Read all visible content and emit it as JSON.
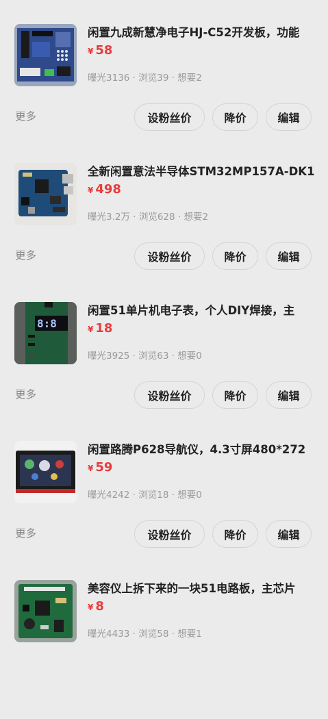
{
  "labels": {
    "more": "更多",
    "fans_price": "设粉丝价",
    "reduce_price": "降价",
    "edit": "编辑",
    "currency": "¥"
  },
  "items": [
    {
      "title": "闲置九成新慧净电子HJ-C52开发板，功能",
      "price": "58",
      "stats": "曝光3136 · 浏览39 · 想要2",
      "image_icon": "dev-board-photo"
    },
    {
      "title": "全新闲置意法半导体STM32MP157A-DK1",
      "price": "498",
      "stats": "曝光3.2万 · 浏览628 · 想要2",
      "image_icon": "stm32-board-photo"
    },
    {
      "title": "闲置51单片机电子表，个人DIY焊接，主",
      "price": "18",
      "stats": "曝光3925 · 浏览63 · 想要0",
      "image_icon": "led-clock-photo"
    },
    {
      "title": "闲置路腾P628导航仪，4.3寸屏480*272",
      "price": "59",
      "stats": "曝光4242 · 浏览18 · 想要0",
      "image_icon": "gps-navigator-photo"
    },
    {
      "title": "美容仪上拆下来的一块51电路板，主芯片",
      "price": "8",
      "stats": "曝光4433 · 浏览58 · 想要1",
      "image_icon": "circuit-board-photo"
    }
  ]
}
